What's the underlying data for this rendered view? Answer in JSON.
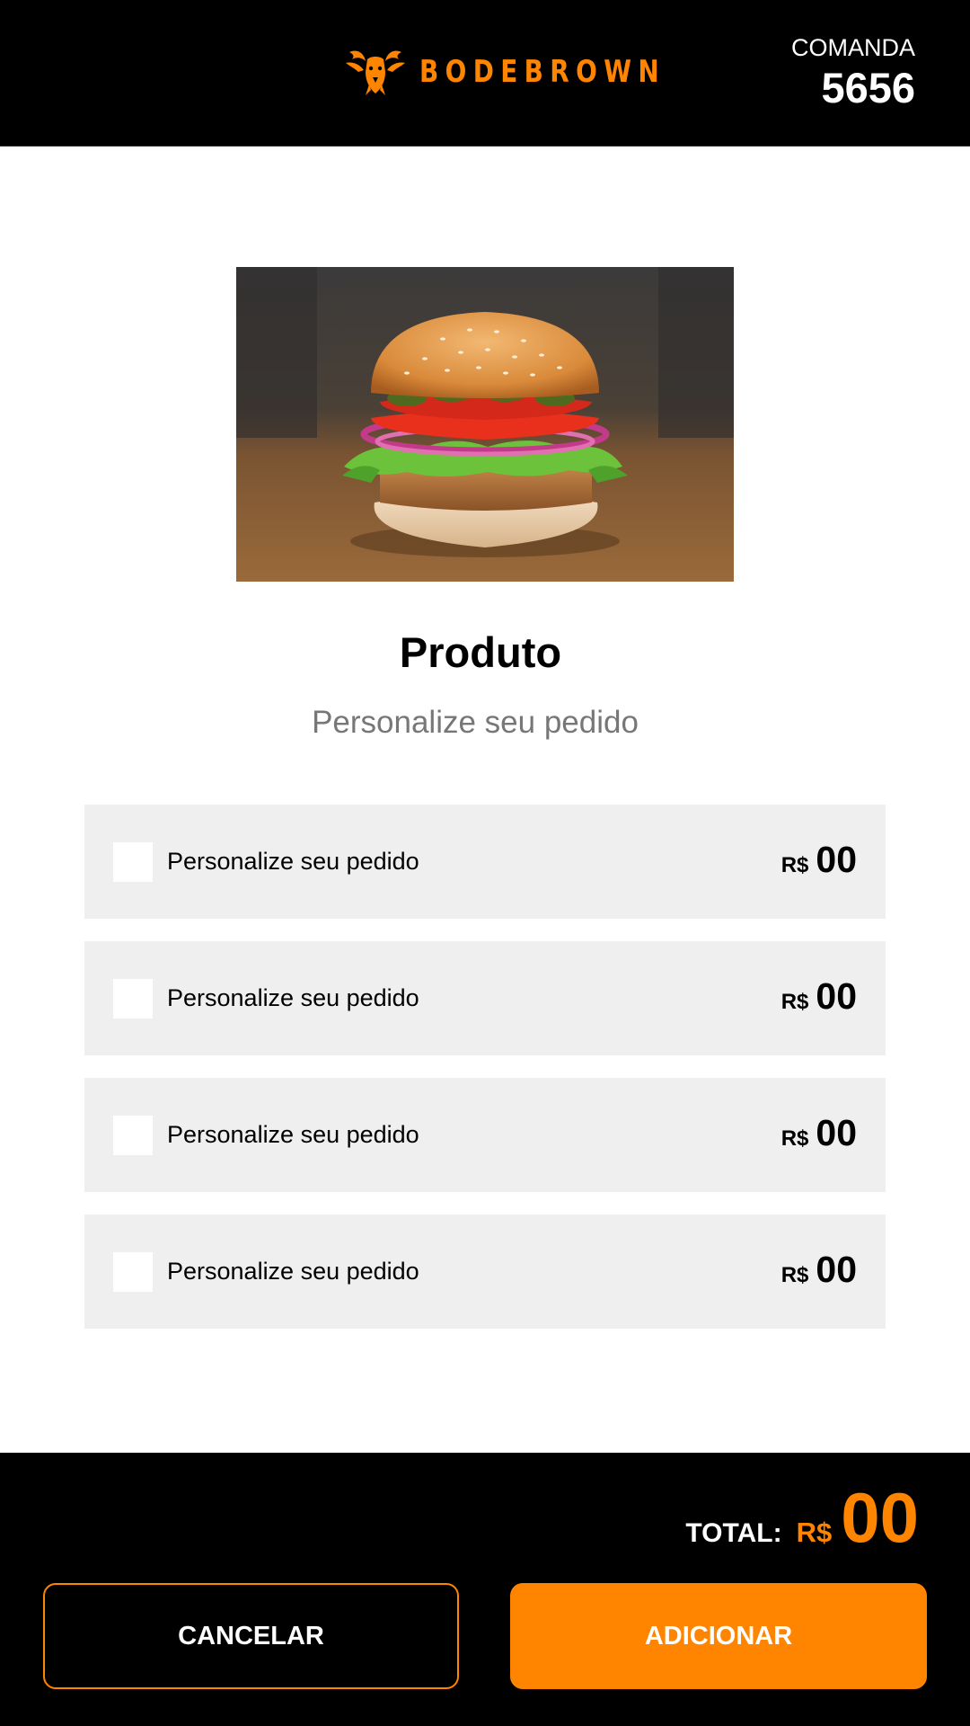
{
  "header": {
    "brand": "BODEBROWN",
    "logo_icon": "goat-head-icon",
    "comanda_label": "COMANDA",
    "comanda_number": "5656"
  },
  "product": {
    "image": "burger-photo",
    "title": "Produto",
    "subtitle": "Personalize seu pedido"
  },
  "options": [
    {
      "label": "Personalize seu pedido",
      "currency": "R$",
      "price": "00",
      "checked": false
    },
    {
      "label": "Personalize seu pedido",
      "currency": "R$",
      "price": "00",
      "checked": false
    },
    {
      "label": "Personalize seu pedido",
      "currency": "R$",
      "price": "00",
      "checked": false
    },
    {
      "label": "Personalize seu pedido",
      "currency": "R$",
      "price": "00",
      "checked": false
    }
  ],
  "footer": {
    "total_label": "TOTAL:",
    "total_currency": "R$",
    "total_value": "00",
    "cancel_label": "CANCELAR",
    "add_label": "ADICIONAR"
  },
  "colors": {
    "accent": "#FF8500",
    "header_bg": "#000000",
    "option_bg": "#EFEFEF",
    "subtitle": "#777777"
  }
}
